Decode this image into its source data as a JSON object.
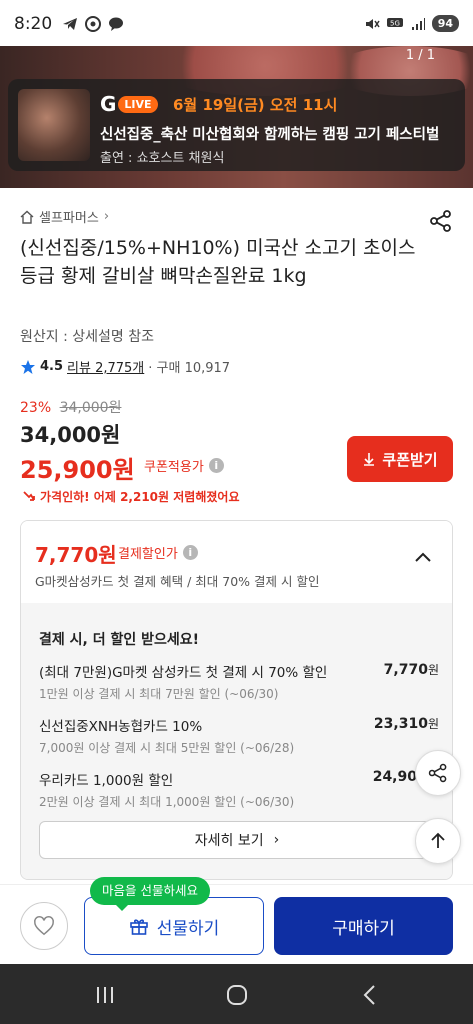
{
  "status_bar": {
    "time": "8:20",
    "battery": "94"
  },
  "banner": {
    "page_indicator": "1 / 1",
    "live_logo": "G",
    "live_badge": "LIVE",
    "schedule": "6월 19일(금) 오전 11시",
    "title": "신선집중_축산 미산협회와 함께하는 캠핑 고기 페스티벌",
    "host": "출연 : 쇼호스트 채원식"
  },
  "product": {
    "store": "셀프파머스",
    "title": "(신선집중/15%+NH10%) 미국산 소고기 초이스 등급 황제 갈비살 뼈막손질완료 1kg",
    "origin": "원산지 : 상세설명 참조",
    "rating": "4.5",
    "reviews": "리뷰 2,775개",
    "purchases": "· 구매 10,917",
    "discount_rate": "23%",
    "original_price": "34,000원",
    "price": "34,000원",
    "sale_price": "25,900원",
    "coupon_label": "쿠폰적용가",
    "coupon_button": "쿠폰받기",
    "price_drop": "가격인하! 어제 2,210원 저렴해졌어요"
  },
  "payment_discount": {
    "price": "7,770원",
    "label": "결제할인가",
    "subtitle": "G마켓삼성카드 첫 결제 혜택 / 최대 70% 결제 시 할인",
    "section_title": "결제 시, 더 할인 받으세요!",
    "offers": [
      {
        "name": "(최대 7만원)G마켓 삼성카드 첫 결제 시 70% 할인",
        "desc": "1만원 이상 결제 시 최대 7만원 할인 (~06/30)",
        "amount": "7,770",
        "unit": "원"
      },
      {
        "name": "신선집중XNH농협카드 10%",
        "desc": "7,000원 이상 결제 시 최대 5만원 할인 (~06/28)",
        "amount": "23,310",
        "unit": "원"
      },
      {
        "name": "우리카드 1,000원 할인",
        "desc": "2만원 이상 결제 시 최대 1,000원 할인 (~06/30)",
        "amount": "24,90",
        "unit": ""
      }
    ],
    "more_button": "자세히 보기"
  },
  "bottom_bar": {
    "gift_tooltip": "마음을 선물하세요",
    "gift_button": "선물하기",
    "buy_button": "구매하기"
  },
  "colors": {
    "accent_red": "#e62e1e",
    "primary_blue": "#0f2fa3",
    "tooltip_green": "#11b94a",
    "live_orange": "#ff6a13"
  }
}
